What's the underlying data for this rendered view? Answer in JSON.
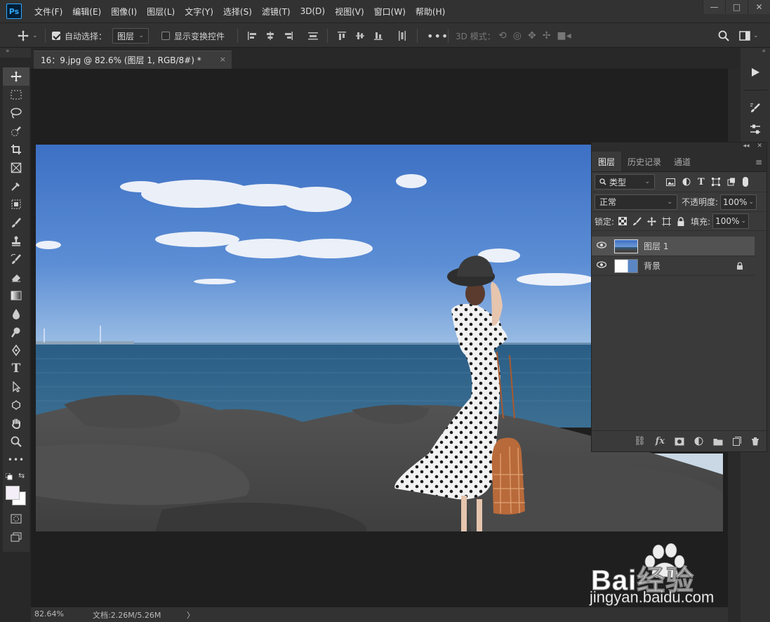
{
  "app": {
    "logo": "Ps"
  },
  "menu": [
    "文件(F)",
    "编辑(E)",
    "图像(I)",
    "图层(L)",
    "文字(Y)",
    "选择(S)",
    "滤镜(T)",
    "3D(D)",
    "视图(V)",
    "窗口(W)",
    "帮助(H)"
  ],
  "window_controls": {
    "minimize": "—",
    "maximize": "□",
    "close": "✕"
  },
  "options_bar": {
    "auto_select_label": "自动选择：",
    "auto_select_checked": true,
    "auto_select_target": "图层",
    "show_transform_label": "显示变换控件",
    "show_transform_checked": false,
    "mode_3d_label": "3D 模式："
  },
  "document_tab": {
    "title": "16：9.jpg @ 82.6% (图层 1, RGB/8#) *",
    "close": "×"
  },
  "status": {
    "zoom": "82.64%",
    "doc_info": "文档:2.26M/5.26M",
    "arrow": "〉"
  },
  "layers_panel": {
    "tabs": [
      "图层",
      "历史记录",
      "通道"
    ],
    "active_tab": "图层",
    "filter_kind": "类型",
    "blend_mode": "正常",
    "opacity_label": "不透明度:",
    "opacity_value": "100%",
    "lock_label": "锁定:",
    "fill_label": "填充:",
    "fill_value": "100%",
    "layers": [
      {
        "name": "图层 1",
        "visible": true,
        "selected": true,
        "locked": false
      },
      {
        "name": "背景",
        "visible": true,
        "selected": false,
        "locked": true
      }
    ]
  },
  "watermark": {
    "brand": "Bai经验",
    "url": "jingyan.baidu.com"
  },
  "colors": {
    "accent": "#31a8ff",
    "foreground": "#f3eef7",
    "background": "#ffffff"
  }
}
